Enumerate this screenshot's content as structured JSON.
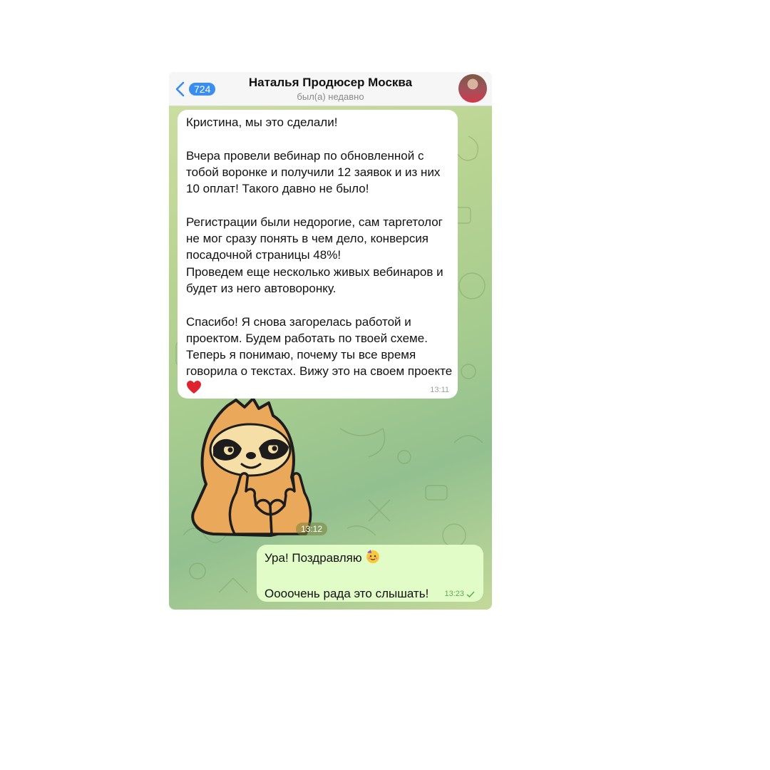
{
  "header": {
    "back_count": "724",
    "title": "Наталья Продюсер Москва",
    "status": "был(а) недавно"
  },
  "messages": [
    {
      "direction": "incoming",
      "text": "Кристина, мы это сделали!\n\nВчера провели вебинар по обновленной с тобой воронке и получили 12 заявок и из них 10 оплат! Такого давно не было!\n\nРегистрации были недорогие, сам таргетолог не мог сразу понять в чем дело, конверсия посадочной страницы 48%!\nПроведем еще несколько живых вебинаров и  будет из него автоворонку.\n\nСпасибо! Я снова загорелась работой и проектом. Будем работать по твоей схеме. Теперь я понимаю, почему ты все время говорила о текстах. Вижу это на своем проекте",
      "emoji": "red-heart",
      "time": "13:11"
    },
    {
      "direction": "incoming",
      "type": "sticker",
      "sticker": "sloth-heart-hands",
      "time": "13:12"
    },
    {
      "direction": "outgoing",
      "line1": "Ура! Поздравляю",
      "emoji": "partying-face",
      "line2": "Оооочень рада это слышать!",
      "time": "13:23",
      "read_status": "sent-check"
    }
  ],
  "colors": {
    "accent": "#3a8ef0",
    "incoming_bubble": "#ffffff",
    "outgoing_bubble": "#e2fcc8",
    "outgoing_time": "#5eaa57"
  }
}
